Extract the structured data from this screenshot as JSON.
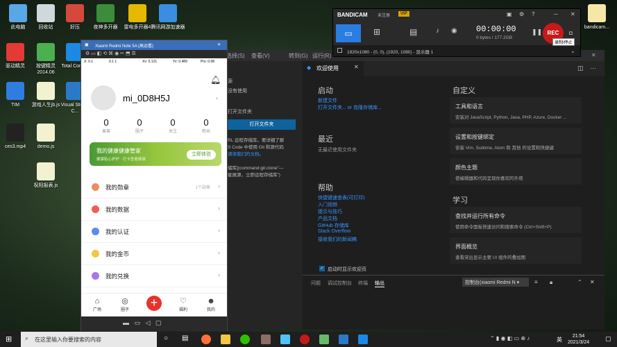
{
  "desktop": {
    "icons": [
      {
        "label": "此电脑",
        "color": "#5aa7e8"
      },
      {
        "label": "回收站",
        "color": "#cfd8dc"
      },
      {
        "label": "好压",
        "color": "#d4493b"
      },
      {
        "label": "夜神多开器",
        "color": "#3c8c3a"
      },
      {
        "label": "雷电多开器4",
        "color": "#e6b800"
      },
      {
        "label": "腾讯网游加速器",
        "color": "#3a8de0"
      },
      {
        "label": "驱动精灵",
        "color": "#e53935"
      },
      {
        "label": "按键精灵 2014.06",
        "color": "#4caf50"
      },
      {
        "label": "Total Control",
        "color": "#1e88e5"
      },
      {
        "label": "TIM",
        "color": "#2f7de1"
      },
      {
        "label": "游戏人生jb.js",
        "color": "#f2f2d0"
      },
      {
        "label": "Visual Studio C...",
        "color": "#2a7ac8"
      },
      {
        "label": "ces3.mp4",
        "color": "#222"
      },
      {
        "label": "demo.js",
        "color": "#f2f2d0"
      },
      {
        "label": "祝阳报表.js",
        "color": "#f2f2d0"
      },
      {
        "label": "bandicam...",
        "color": "#f5e7a8"
      }
    ]
  },
  "phone": {
    "title": "Xiaomi Redmi Note 5A (高运看)",
    "status": [
      "X: 0.1",
      "0.1 1",
      "Xv: 0.121",
      "Yv: 0.489",
      "Prs: 0.08"
    ],
    "username": "mi_0D8H5J",
    "stats": [
      {
        "n": "0",
        "l": "果果"
      },
      {
        "n": "0",
        "l": "圈子"
      },
      {
        "n": "0",
        "l": "关注"
      },
      {
        "n": "0",
        "l": "粉丝"
      }
    ],
    "banner": {
      "title": "我的健康健康管家",
      "sub": "健康贴心护护 · 打卡查看健康",
      "button": "立即体验"
    },
    "menu": [
      {
        "label": "我的勋章",
        "extra": "1个勋章",
        "color": "#f08a5d"
      },
      {
        "label": "我的数据",
        "extra": "",
        "color": "#f25c54"
      },
      {
        "label": "我的认证",
        "extra": "",
        "color": "#5b8def"
      },
      {
        "label": "我的金币",
        "extra": "",
        "color": "#f6c343"
      },
      {
        "label": "我的兑换",
        "extra": "",
        "color": "#a876e8"
      }
    ],
    "nav": [
      {
        "label": "广场",
        "icon": "⌂"
      },
      {
        "label": "圈子",
        "icon": "◎"
      },
      {
        "label": "福利",
        "icon": "♡"
      },
      {
        "label": "我的",
        "icon": "☻"
      }
    ],
    "plus": "+"
  },
  "vscode": {
    "menus": [
      "选择(S)",
      "查看(V)",
      "转到(G)",
      "运行(R)"
    ],
    "tab": "欢迎使用",
    "sidebar": {
      "heading": "源",
      "sub": "没有使用",
      "folder_label": "打开文件夹",
      "open_button": "打开文件夹",
      "text1": "RL 远程存储库。要详细了解",
      "text2": "S Code 中使用 Git 和源代码",
      "text3": "请读我们的文档。",
      "text4": "储库](command:git.clone\"—",
      "text5": "星展源，立即远程存储库\")"
    },
    "welcome": {
      "start_h": "启动",
      "new_file": "新建文件",
      "open_file": "打开文件夹... or 克隆存储库...",
      "recent_h": "最近",
      "recent_none": "无最近使用文件夹",
      "help_h": "帮助",
      "help_links": [
        "快捷键速查表(可打印)",
        "入门视频",
        "提示与技巧",
        "产品文档",
        "GitHub 存储库",
        "Stack Overflow",
        "接收我们的新闻稿"
      ],
      "custom_h": "自定义",
      "learn_h": "学习",
      "cards": [
        {
          "t": "工具和语言",
          "d": "安装对 JavaScript, Python, Java, PHP, Azure, Docker ..."
        },
        {
          "t": "设置和按键绑定",
          "d": "安装 Vim, Sublime, Atom 和 其他 的设置和快捷键"
        },
        {
          "t": "颜色主题",
          "d": "使编辑器和代码呈现你喜欢的外观"
        },
        {
          "t": "查找并运行所有命令",
          "d": "使用命令面板快速访问和搜索命令 (Ctrl+Shift+P)"
        },
        {
          "t": "界面概览",
          "d": "查看突出显示主要 UI 组件的叠加图"
        }
      ],
      "checkbox": "启动时显示欢迎页"
    },
    "panel": {
      "tabs": [
        "问题",
        "调试控制台",
        "终端",
        "输出"
      ],
      "dropdown": "控制台(xiaomi Redmi N"
    }
  },
  "bandicam": {
    "brand": "BANDICAM",
    "unreg": "未注册",
    "vip": "VIP",
    "time": "00:00:00",
    "size": "0 bytes / 177.2GB",
    "rec": "REC",
    "res": "1920x1080 - (0, 0), (1920, 1080) - 显示器 1",
    "tooltip": "录制/停止"
  },
  "taskbar": {
    "search": "在这里输入你要搜索的内容",
    "time": "21:54",
    "date": "2021/3/24",
    "lang": "英"
  }
}
